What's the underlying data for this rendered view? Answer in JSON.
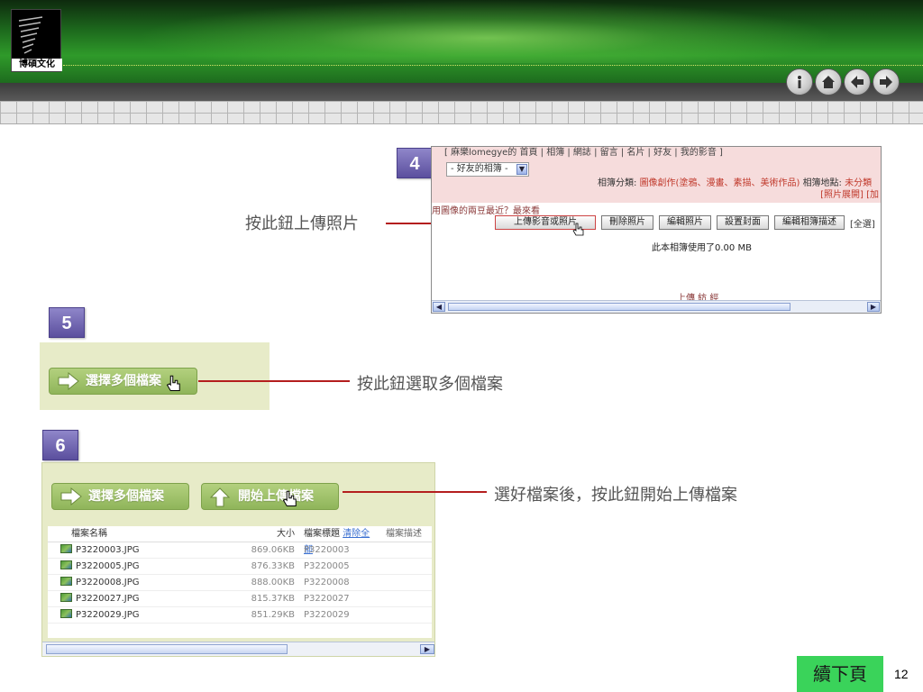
{
  "logo": {
    "text": "博碩文化"
  },
  "nav_buttons": [
    "info-icon",
    "home-icon",
    "back-arrow-icon",
    "forward-arrow-icon"
  ],
  "steps": {
    "step4": {
      "number": "4",
      "callout": "按此鈕上傳照片",
      "screenshot": {
        "top_nav": "[ 麻樂lomegye的 首頁 | 相簿 | 網誌 | 留言 | 名片 | 好友 | 我的影音 ]",
        "album_select": "- 好友的相簿 -",
        "category_label": "相簿分類:",
        "category_value": "圖像創作(塗鴉、漫畫、素描、美術作品)",
        "location_label": "相簿地點:",
        "location_value": "未分類",
        "photo_list_link": "[照片展開] [加",
        "tip": "用圖像的兩豆最近？最來看",
        "buttons": [
          "上傳影音或照片",
          "刪除照片",
          "編輯照片",
          "設置封面",
          "編輯相簿描述"
        ],
        "select_all": "[全選]",
        "usage": "此本相簿使用了0.00 MB",
        "upload_progress": "上傳 紡 經"
      }
    },
    "step5": {
      "number": "5",
      "callout": "按此鈕選取多個檔案",
      "button": "選擇多個檔案"
    },
    "step6": {
      "number": "6",
      "callout": "選好檔案後，按此鈕開始上傳檔案",
      "buttons": {
        "select": "選擇多個檔案",
        "upload": "開始上傳檔案"
      },
      "table": {
        "headers": {
          "name": "檔案名稱",
          "size": "大小",
          "title": "檔案標題",
          "clear": "清除全部",
          "desc": "檔案描述"
        },
        "rows": [
          {
            "name": "P3220003.JPG",
            "size": "869.06KB",
            "title": "P3220003"
          },
          {
            "name": "P3220005.JPG",
            "size": "876.33KB",
            "title": "P3220005"
          },
          {
            "name": "P3220008.JPG",
            "size": "888.00KB",
            "title": "P3220008"
          },
          {
            "name": "P3220027.JPG",
            "size": "815.37KB",
            "title": "P3220027"
          },
          {
            "name": "P3220029.JPG",
            "size": "851.29KB",
            "title": "P3220029"
          }
        ]
      }
    }
  },
  "footer": {
    "next_page": "續下頁",
    "page_number": "12"
  },
  "colors": {
    "accent_red": "#b41e1e",
    "badge_purple": "#5b4f9e",
    "next_green": "#3ad35a"
  }
}
